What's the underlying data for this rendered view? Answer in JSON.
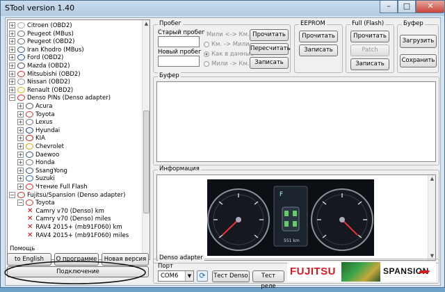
{
  "app": {
    "title": "STool version 1.40",
    "window_controls": [
      "minimize",
      "maximize",
      "close"
    ]
  },
  "tree": {
    "items": [
      {
        "label": "Citroen (OBD2)",
        "level": 0,
        "expander": "+",
        "icon": "citroen-logo"
      },
      {
        "label": "Peugeot (MBus)",
        "level": 0,
        "expander": "+",
        "icon": "peugeot-logo"
      },
      {
        "label": "Peugeot (OBD2)",
        "level": 0,
        "expander": "+",
        "icon": "peugeot-logo"
      },
      {
        "label": "Iran Khodro (MBus)",
        "level": 0,
        "expander": "+",
        "icon": "ikco-logo"
      },
      {
        "label": "Ford (OBD2)",
        "level": 0,
        "expander": "+",
        "icon": "ford-logo"
      },
      {
        "label": "Mazda (OBD2)",
        "level": 0,
        "expander": "+",
        "icon": "mazda-logo"
      },
      {
        "label": "Mitsubishi (OBD2)",
        "level": 0,
        "expander": "+",
        "icon": "mitsubishi-logo"
      },
      {
        "label": "Nissan (OBD2)",
        "level": 0,
        "expander": "+",
        "icon": "nissan-logo"
      },
      {
        "label": "Renault (OBD2)",
        "level": 0,
        "expander": "+",
        "icon": "renault-logo"
      },
      {
        "label": "Denso PINs (Denso adapter)",
        "level": 0,
        "expander": "−",
        "icon": "denso-logo"
      },
      {
        "label": "Acura",
        "level": 1,
        "expander": "+",
        "icon": "acura-logo"
      },
      {
        "label": "Toyota",
        "level": 1,
        "expander": "+",
        "icon": "toyota-logo"
      },
      {
        "label": "Lexus",
        "level": 1,
        "expander": "+",
        "icon": "lexus-logo"
      },
      {
        "label": "Hyundai",
        "level": 1,
        "expander": "+",
        "icon": "hyundai-logo"
      },
      {
        "label": "KIA",
        "level": 1,
        "expander": "+",
        "icon": "kia-logo"
      },
      {
        "label": "Chevrolet",
        "level": 1,
        "expander": "+",
        "icon": "chevrolet-logo"
      },
      {
        "label": "Daewoo",
        "level": 1,
        "expander": "+",
        "icon": "daewoo-logo"
      },
      {
        "label": "Honda",
        "level": 1,
        "expander": "+",
        "icon": "honda-logo"
      },
      {
        "label": "SsangYong",
        "level": 1,
        "expander": "+",
        "icon": "ssangyong-logo"
      },
      {
        "label": "Suzuki",
        "level": 1,
        "expander": "+",
        "icon": "suzuki-logo"
      },
      {
        "label": "Чтение Full Flash",
        "level": 1,
        "expander": "+",
        "icon": "denso-logo"
      },
      {
        "label": "Fujitsu/Spansion (Denso adapter)",
        "level": 0,
        "expander": "−",
        "icon": "fujitsu-logo"
      },
      {
        "label": "Toyota",
        "level": 1,
        "expander": "−",
        "icon": "toyota-logo"
      },
      {
        "label": "Camry v70 (Denso) km",
        "level": 2,
        "expander": "",
        "icon": "x-mark-icon"
      },
      {
        "label": "Camry v70 (Denso) miles",
        "level": 2,
        "expander": "",
        "icon": "x-mark-icon"
      },
      {
        "label": "RAV4 2015+ (mb91F060) km",
        "level": 2,
        "expander": "",
        "icon": "x-mark-icon"
      },
      {
        "label": "RAV4 2015+ (mb91F060) miles",
        "level": 2,
        "expander": "",
        "icon": "x-mark-icon"
      }
    ]
  },
  "help": {
    "label": "Помощь",
    "buttons": [
      "to English",
      "О программе",
      "Новая версия"
    ],
    "connect": "Подключение"
  },
  "mileage": {
    "group_label": "Пробег",
    "old_label": "Старый пробег",
    "new_label": "Новый пробег",
    "old_value": "",
    "new_value": "",
    "converter_label": "Мили <-> Км.",
    "radios": [
      "Км. -> Мили",
      "Как в данные",
      "Мили -> Км."
    ],
    "selected_radio": 1,
    "buttons": [
      "Прочитать",
      "Пересчитать",
      "Записать"
    ]
  },
  "eeprom": {
    "label": "EEPROM",
    "buttons": [
      "Прочитать",
      "Записать"
    ]
  },
  "flash": {
    "label": "Full (Flash)",
    "buttons": [
      "Прочитать",
      "Patch",
      "Записать"
    ],
    "patch_disabled": true
  },
  "buffer_group": {
    "label": "Буфер",
    "buttons": [
      "Загрузить",
      "Сохранить"
    ]
  },
  "buffer_panel": {
    "label": "Буфер",
    "content": ""
  },
  "info_panel": {
    "label": "Информация",
    "odometer_text": "551 km"
  },
  "adapter": {
    "label": "Denso adapter",
    "port_label": "Порт",
    "port_value": "COM6",
    "refresh_icon": "refresh-icon",
    "buttons": [
      "Тест Denso",
      "Тест реле"
    ]
  },
  "brands": {
    "fujitsu": "FUJITSU",
    "spansion": "SPANSION"
  },
  "colors": {
    "window_chrome": "#d4e3f0",
    "fujitsu_red": "#d7191f",
    "spansion_black": "#111111"
  }
}
